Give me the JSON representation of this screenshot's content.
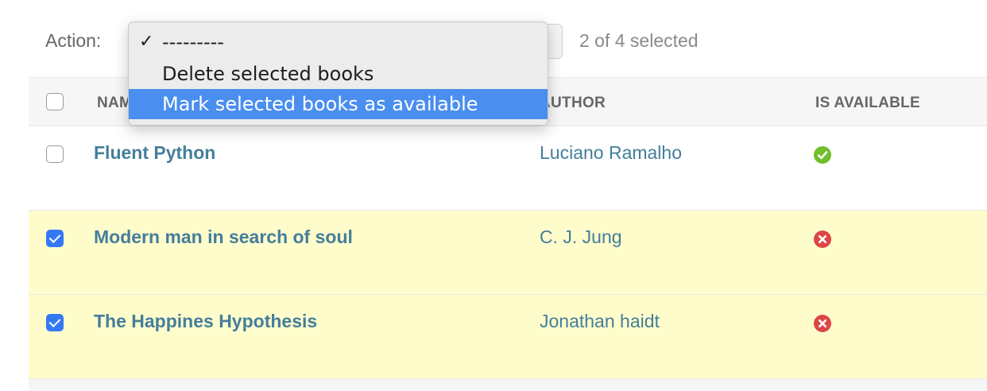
{
  "action_bar": {
    "label": "Action:",
    "selection_count": "2 of 4 selected"
  },
  "dropdown": {
    "options": [
      {
        "label": "---------",
        "selected": true
      },
      {
        "label": "Delete selected books",
        "selected": false
      },
      {
        "label": "Mark selected books as available",
        "selected": false,
        "highlighted": true
      }
    ],
    "checkmark": "✓"
  },
  "table": {
    "columns": [
      "NAME",
      "AUTHOR",
      "IS AVAILABLE"
    ],
    "rows": [
      {
        "name": "Fluent Python",
        "author": "Luciano Ramalho",
        "is_available": true,
        "checked": false
      },
      {
        "name": "Modern man in search of soul",
        "author": "C. J. Jung",
        "is_available": false,
        "checked": true
      },
      {
        "name": "The Happines Hypothesis",
        "author": "Jonathan haidt",
        "is_available": false,
        "checked": true
      }
    ]
  },
  "colors": {
    "link": "#447e9b",
    "selected_row": "#fffccc",
    "checkbox_checked": "#3478f6",
    "available_yes": "#70bf2b",
    "available_no": "#dd4646",
    "menu_highlight": "#4a8ef0"
  },
  "icons": {
    "available_yes": "check-circle-icon",
    "available_no": "x-circle-icon"
  }
}
